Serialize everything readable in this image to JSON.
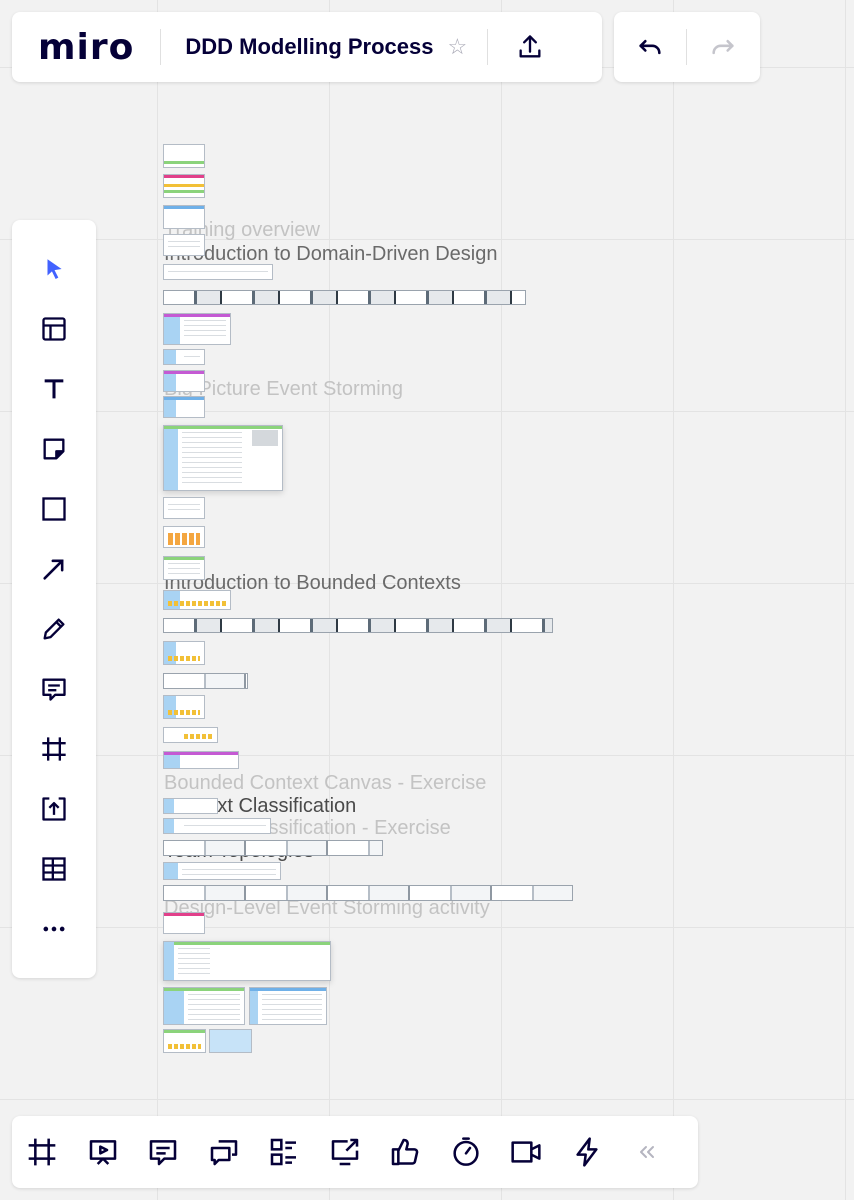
{
  "header": {
    "logo": "miro",
    "board_title": "DDD Modelling Process",
    "star_icon": "star-icon",
    "share_icon": "upload-icon"
  },
  "history": {
    "undo_icon": "undo-icon",
    "redo_icon": "redo-icon"
  },
  "toolbar": {
    "tools": [
      "select-icon",
      "templates-icon",
      "text-icon",
      "sticky-note-icon",
      "shape-icon",
      "arrow-icon",
      "pen-icon",
      "comment-icon",
      "frame-icon",
      "upload-icon",
      "table-icon",
      "more-icon"
    ]
  },
  "bottom_toolbar": {
    "items": [
      "frames-icon",
      "presentation-icon",
      "comments-icon",
      "chat-icon",
      "card-list-icon",
      "share-screen-icon",
      "voting-icon",
      "timer-icon",
      "video-icon",
      "apps-icon",
      "collapse-icon"
    ]
  },
  "canvas": {
    "frames": [
      {
        "title": "Training overview",
        "faded": true
      },
      {
        "title": "Introduction to Domain-Driven Design",
        "faded": false
      },
      {
        "title": "Big Picture Event Storming",
        "faded": true
      },
      {
        "title": "Introduction to Bounded Contexts",
        "faded": false
      },
      {
        "title": "Bounded Context Canvas - Exercise",
        "faded": true
      },
      {
        "title": "Context Classification",
        "faded": false
      },
      {
        "title": "Context Classification - Exercise",
        "faded": true
      },
      {
        "title": "Team Topologies",
        "faded": false
      },
      {
        "title": "Design-Level Event Storming activity",
        "faded": true
      }
    ]
  },
  "colors": {
    "accent": "#4262ff",
    "ink": "#050038"
  }
}
